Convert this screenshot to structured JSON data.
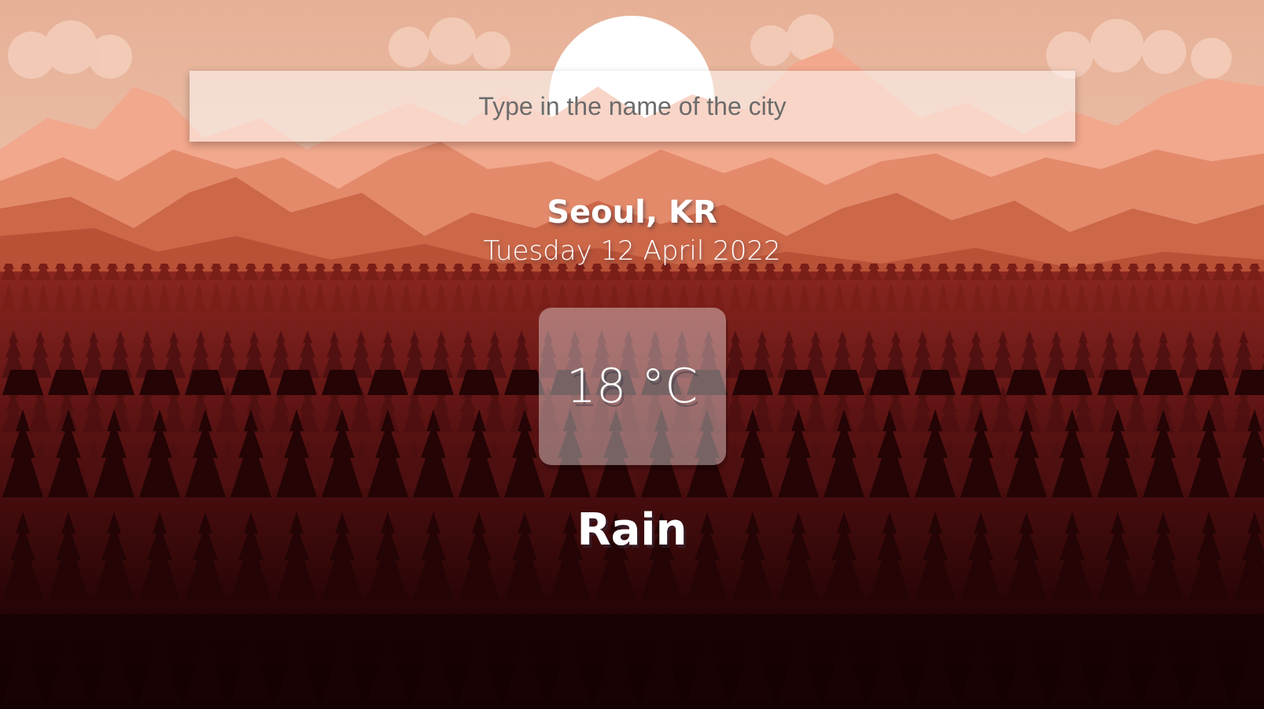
{
  "search": {
    "placeholder": "Type in the name of the city",
    "value": ""
  },
  "location": {
    "city_country": "Seoul, KR",
    "date": "Tuesday 12 April 2022"
  },
  "weather": {
    "temperature": "18 °C",
    "condition": "Rain"
  },
  "theme": {
    "sky_top": "#e9b79d",
    "sky_bottom": "#f6d9c8",
    "mountain_light": "#f0a287",
    "mountain_mid": "#db7758",
    "mountain_dark": "#bb5a3d",
    "forest_far": "#8f2a1f",
    "forest_near": "#1a0203"
  }
}
